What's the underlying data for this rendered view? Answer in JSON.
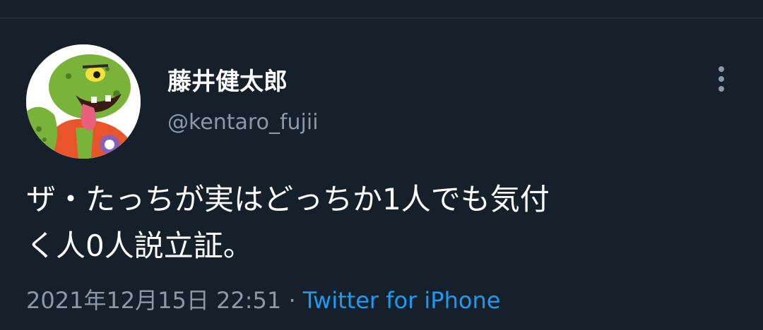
{
  "tweet": {
    "author": {
      "display_name": "藤井健太郎",
      "handle": "@kentaro_fujii",
      "avatar_icon": "ogre-avatar-icon"
    },
    "text_line1": "ザ・たっちが実はどっちか1人でも気付",
    "text_line2": "く人0人説立証。",
    "timestamp": "2021年12月15日 22:51",
    "separator": "·",
    "source": "Twitter for iPhone"
  },
  "colors": {
    "background": "#15202b",
    "primary_text": "#ffffff",
    "secondary_text": "#8b98a5",
    "link": "#1d9bf0"
  }
}
